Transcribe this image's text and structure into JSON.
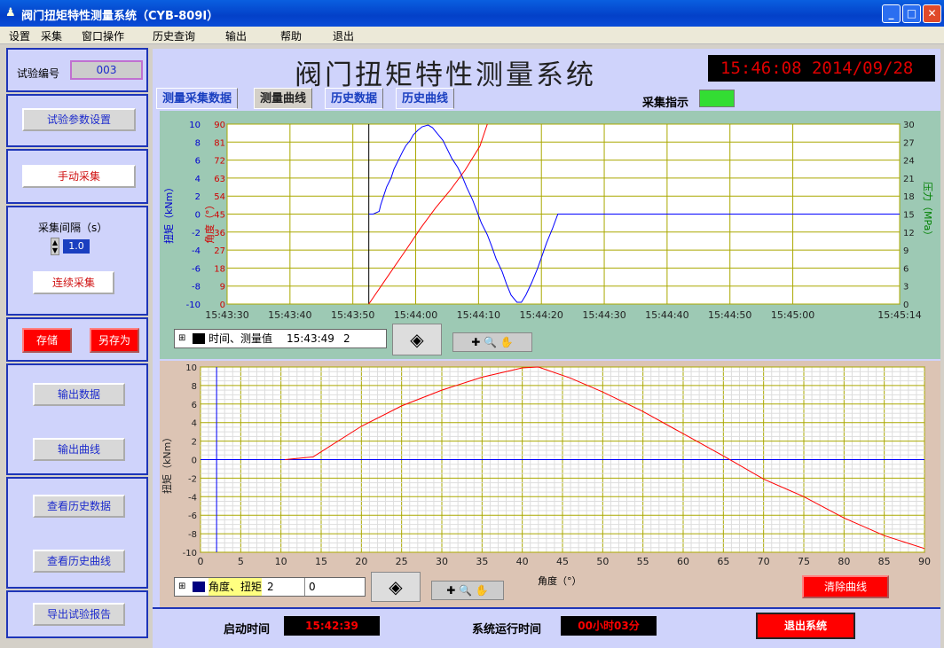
{
  "window": {
    "title": "阀门扭矩特性测量系统（CYB-809I）"
  },
  "menu": [
    "设置",
    "采集",
    "窗口操作",
    "历史查询",
    "输出",
    "帮助",
    "退出"
  ],
  "left": {
    "test_no_label": "试验编号",
    "test_no_value": "003",
    "param_btn": "试验参数设置",
    "manual_btn": "手动采集",
    "interval_label": "采集间隔（s）",
    "interval_value": "1.0",
    "continuous_btn": "连续采集",
    "save_btn": "存储",
    "saveas_btn": "另存为",
    "export_data_btn": "输出数据",
    "export_curve_btn": "输出曲线",
    "view_hist_data_btn": "查看历史数据",
    "view_hist_curve_btn": "查看历史曲线",
    "report_btn": "导出试验报告"
  },
  "header": {
    "app_title": "阀门扭矩特性测量系统",
    "clock": "15:46:08  2014/09/28"
  },
  "tabs": [
    "测量采集数据",
    "测量曲线",
    "历史数据",
    "历史曲线"
  ],
  "indicator_label": "采集指示",
  "colors": {
    "torque": "#0000ff",
    "angle": "#ff0000",
    "pressure": "#008000",
    "indicator": "#33dd33"
  },
  "legend1": {
    "label": "时间、测量值",
    "time": "15:43:49",
    "value": "2"
  },
  "legend2": {
    "label": "角度、扭矩",
    "value1": "2",
    "value2": "0"
  },
  "clear_btn": "清除曲线",
  "bottom": {
    "start_label": "启动时间",
    "start_value": "15:42:39",
    "run_label": "系统运行时间",
    "run_value": "00小时03分",
    "exit_btn": "退出系统"
  },
  "chart_data": [
    {
      "type": "line",
      "x_ticks": [
        "15:43:30",
        "15:43:40",
        "15:43:50",
        "15:44:00",
        "15:44:10",
        "15:44:20",
        "15:44:30",
        "15:44:40",
        "15:44:50",
        "15:45:00",
        "15:45:14"
      ],
      "y_left_ticks": [
        "10",
        "8",
        "6",
        "4",
        "2",
        "0",
        "-2",
        "-4",
        "-6",
        "-8",
        "-10"
      ],
      "y_mid_ticks": [
        "90",
        "81",
        "72",
        "63",
        "54",
        "45",
        "36",
        "27",
        "18",
        "9",
        "0"
      ],
      "y_right_ticks": [
        "30",
        "27",
        "24",
        "21",
        "18",
        "15",
        "12",
        "9",
        "6",
        "3",
        "0"
      ],
      "ylabel_left": "扭矩（kNm）",
      "ylabel_mid": "角度（°）",
      "ylabel_right": "压力（MPa）",
      "series": [
        {
          "values_x": [
            140,
            143,
            147,
            148,
            150,
            152,
            155,
            157,
            160,
            163,
            165,
            168,
            170,
            173,
            176,
            180,
            183,
            186,
            190,
            193,
            196,
            200,
            203,
            206,
            210,
            213,
            216,
            220,
            223,
            226,
            230,
            233,
            236,
            240,
            243,
            246,
            250,
            254,
            257,
            260,
            264
          ],
          "values_y": [
            0,
            0,
            0.3,
            1,
            2,
            3,
            4,
            5,
            6,
            7,
            7.6,
            8.2,
            8.8,
            9.3,
            9.7,
            9.9,
            9.6,
            9,
            8.2,
            7.2,
            6.2,
            5.2,
            4.2,
            3,
            1.6,
            0.3,
            -1,
            -2.3,
            -3.6,
            -5,
            -6.4,
            -7.8,
            -9,
            -9.8,
            -9.8,
            -9,
            -7.6,
            -6,
            -4.6,
            -3.2,
            -1.6
          ]
        },
        {
          "values_x": [
            140,
            152,
            165,
            175,
            185,
            195,
            205,
            215,
            220
          ],
          "values_y": [
            0,
            13,
            27,
            38,
            48,
            57,
            67,
            79,
            90
          ]
        }
      ]
    },
    {
      "type": "line",
      "x_ticks": [
        "0",
        "5",
        "10",
        "15",
        "20",
        "25",
        "30",
        "35",
        "40",
        "45",
        "50",
        "55",
        "60",
        "65",
        "70",
        "75",
        "80",
        "85",
        "90"
      ],
      "y_ticks": [
        "10",
        "8",
        "6",
        "4",
        "2",
        "0",
        "-2",
        "-4",
        "-6",
        "-8",
        "-10"
      ],
      "xlabel": "角度（°）",
      "ylabel": "扭矩（kNm）",
      "series": [
        {
          "x": [
            10.5,
            14,
            20,
            25,
            30,
            35,
            40,
            42,
            46,
            50,
            55,
            60,
            65,
            70,
            75,
            80,
            85,
            90
          ],
          "y": [
            0,
            0.3,
            3.6,
            5.8,
            7.5,
            8.9,
            9.9,
            10,
            8.8,
            7.3,
            5.2,
            2.8,
            0.4,
            -2.1,
            -4,
            -6.3,
            -8.2,
            -9.6
          ]
        }
      ]
    }
  ]
}
